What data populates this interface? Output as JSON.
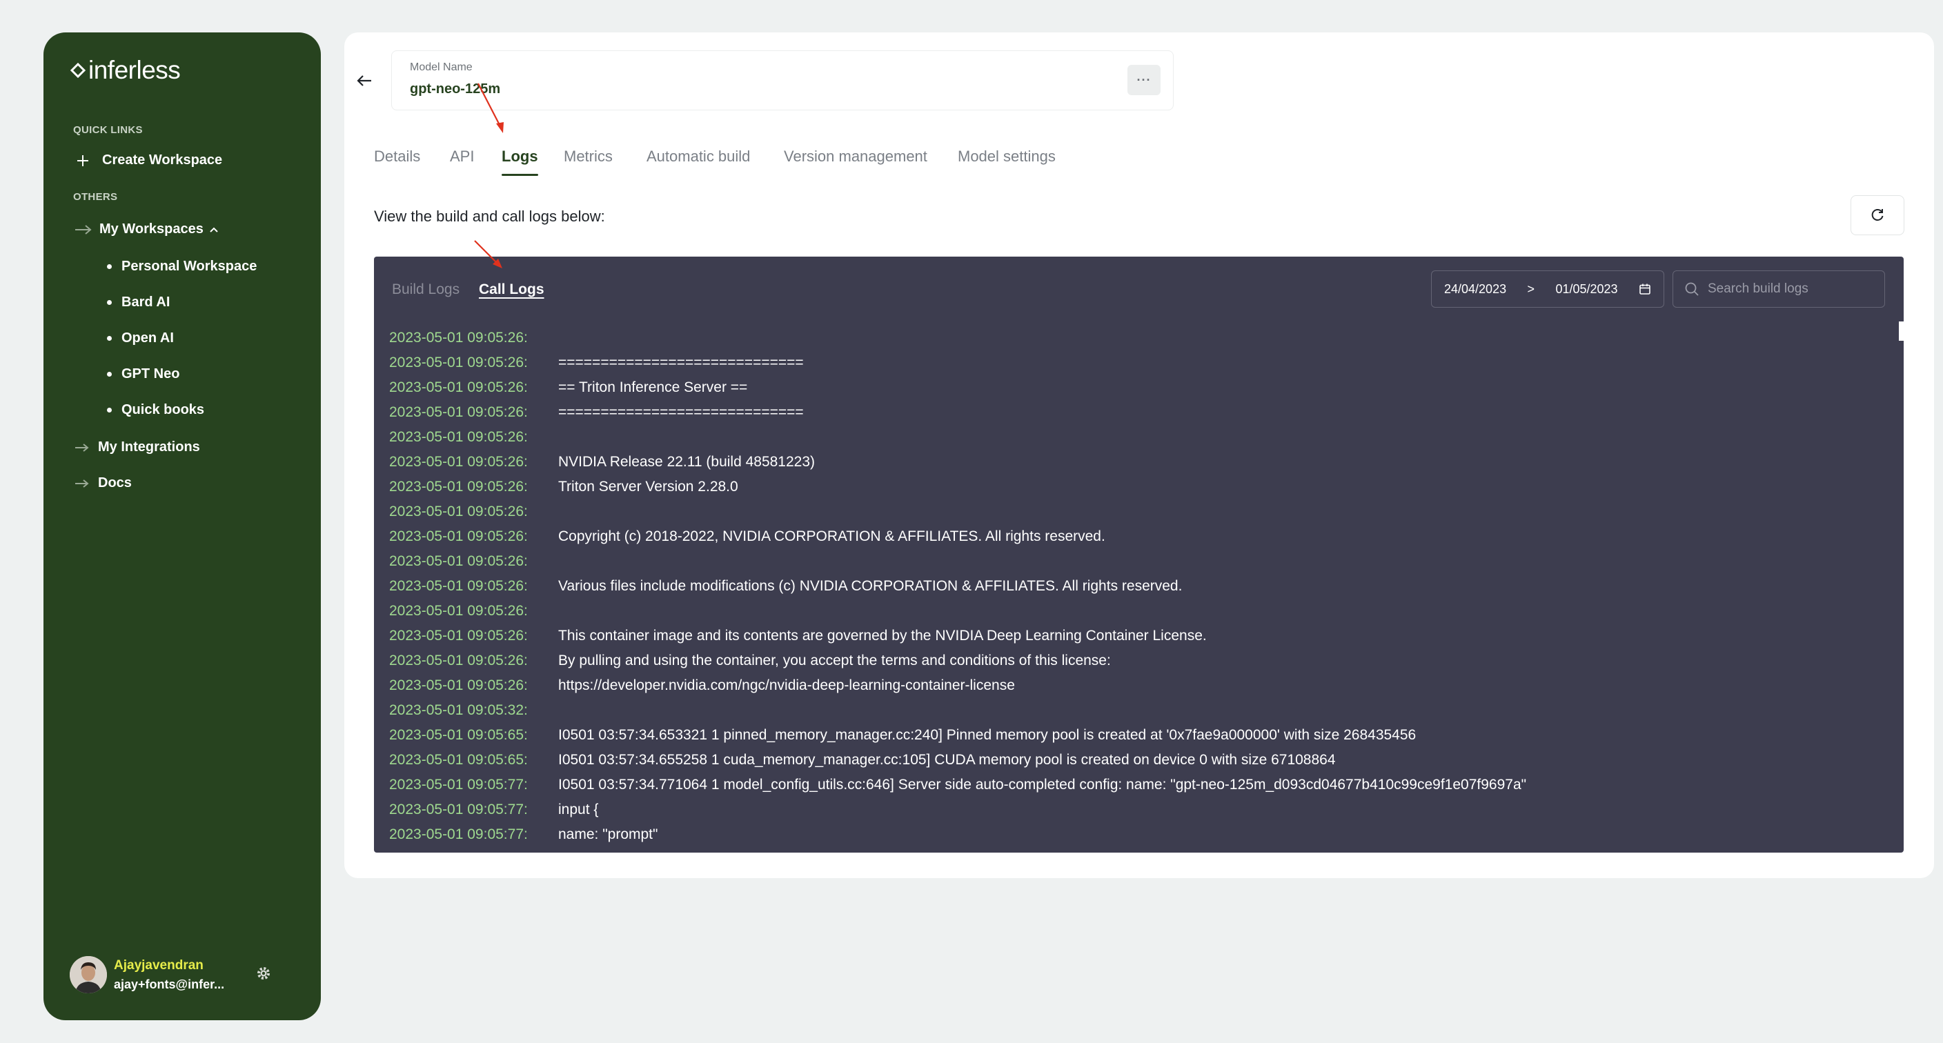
{
  "sidebar": {
    "logo_text": "inferless",
    "quick_links_heading": "QUICK LINKS",
    "create_workspace": "Create Workspace",
    "others_heading": "OTHERS",
    "my_workspaces": "My Workspaces",
    "workspaces": [
      {
        "label": "Personal Workspace"
      },
      {
        "label": "Bard AI"
      },
      {
        "label": "Open AI"
      },
      {
        "label": "GPT Neo"
      },
      {
        "label": "Quick books"
      }
    ],
    "my_integrations": "My Integrations",
    "docs": "Docs",
    "user": {
      "name": "Ajayjavendran",
      "email": "ajay+fonts@infer..."
    }
  },
  "model": {
    "label": "Model Name",
    "name": "gpt-neo-125m",
    "more_label": "···"
  },
  "tabs": [
    {
      "label": "Details"
    },
    {
      "label": "API"
    },
    {
      "label": "Logs"
    },
    {
      "label": "Metrics"
    },
    {
      "label": "Automatic build"
    },
    {
      "label": "Version management"
    },
    {
      "label": "Model settings"
    }
  ],
  "active_tab": "Logs",
  "subtitle": "View the build and call logs below:",
  "logs": {
    "build_tab": "Build Logs",
    "call_tab": "Call Logs",
    "date_from": "24/04/2023",
    "date_sep": ">",
    "date_to": "01/05/2023",
    "search_placeholder": "Search build logs",
    "lines": [
      {
        "ts": "2023-05-01 09:05:26:",
        "msg": ""
      },
      {
        "ts": "2023-05-01 09:05:26:",
        "msg": "============================="
      },
      {
        "ts": "2023-05-01 09:05:26:",
        "msg": "== Triton Inference Server =="
      },
      {
        "ts": "2023-05-01 09:05:26:",
        "msg": "============================="
      },
      {
        "ts": "2023-05-01 09:05:26:",
        "msg": ""
      },
      {
        "ts": "2023-05-01 09:05:26:",
        "msg": "NVIDIA Release 22.11 (build 48581223)"
      },
      {
        "ts": "2023-05-01 09:05:26:",
        "msg": "Triton Server Version 2.28.0"
      },
      {
        "ts": "2023-05-01 09:05:26:",
        "msg": ""
      },
      {
        "ts": "2023-05-01 09:05:26:",
        "msg": "Copyright (c) 2018-2022, NVIDIA CORPORATION & AFFILIATES. All rights reserved."
      },
      {
        "ts": "2023-05-01 09:05:26:",
        "msg": ""
      },
      {
        "ts": "2023-05-01 09:05:26:",
        "msg": "Various files include modifications (c) NVIDIA CORPORATION & AFFILIATES. All rights reserved."
      },
      {
        "ts": "2023-05-01 09:05:26:",
        "msg": ""
      },
      {
        "ts": "2023-05-01 09:05:26:",
        "msg": "This container image and its contents are governed by the NVIDIA Deep Learning Container License."
      },
      {
        "ts": "2023-05-01 09:05:26:",
        "msg": "By pulling and using the container, you accept the terms and conditions of this license:"
      },
      {
        "ts": "2023-05-01 09:05:26:",
        "msg": "https://developer.nvidia.com/ngc/nvidia-deep-learning-container-license"
      },
      {
        "ts": "2023-05-01 09:05:32:",
        "msg": ""
      },
      {
        "ts": "2023-05-01 09:05:65:",
        "msg": "I0501 03:57:34.653321 1 pinned_memory_manager.cc:240] Pinned memory pool is created at '0x7fae9a000000' with size 268435456"
      },
      {
        "ts": "2023-05-01 09:05:65:",
        "msg": "I0501 03:57:34.655258 1 cuda_memory_manager.cc:105] CUDA memory pool is created on device 0 with size 67108864"
      },
      {
        "ts": "2023-05-01 09:05:77:",
        "msg": "I0501 03:57:34.771064 1 model_config_utils.cc:646] Server side auto-completed config: name: \"gpt-neo-125m_d093cd04677b410c99ce9f1e07f9697a\""
      },
      {
        "ts": "2023-05-01 09:05:77:",
        "msg": "input {"
      },
      {
        "ts": "2023-05-01 09:05:77:",
        "msg": "name: \"prompt\""
      }
    ]
  },
  "colors": {
    "sidebar_bg": "#27431f",
    "accent": "#27431f",
    "log_bg": "#3d3d4f",
    "timestamp": "#9fd98f",
    "username": "#e6ec4a",
    "annotation_arrow": "#e0321e"
  },
  "icons": {
    "logo": "inferless-logo-icon",
    "create": "plus-icon",
    "nav_arrow": "arrow-right-icon",
    "back": "arrow-left-icon",
    "refresh": "refresh-icon",
    "calendar": "calendar-icon",
    "search": "search-icon",
    "settings": "gear-icon"
  }
}
